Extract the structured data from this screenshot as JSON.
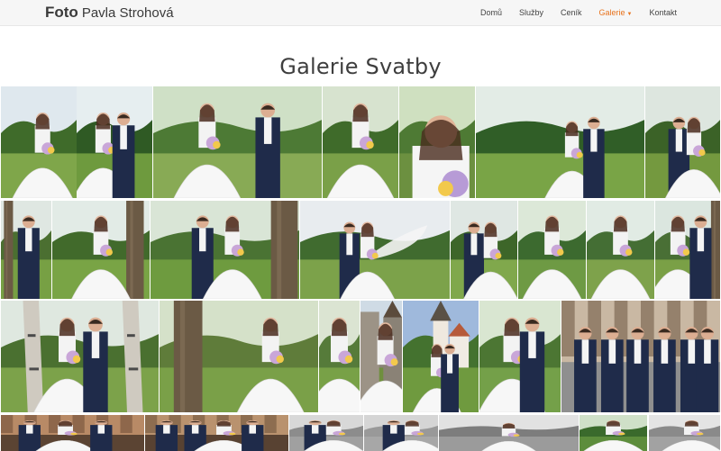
{
  "brand": {
    "bold": "Foto",
    "name": "Pavla Strohová"
  },
  "nav": [
    {
      "label": "Domů",
      "active": false
    },
    {
      "label": "Služby",
      "active": false
    },
    {
      "label": "Ceník",
      "active": false
    },
    {
      "label": "Galerie",
      "active": true,
      "dropdown": true
    },
    {
      "label": "Kontakt",
      "active": false
    }
  ],
  "page_title": "Galerie Svatby",
  "colors": {
    "accent": "#e8731d",
    "navbar_bg": "#f6f6f6"
  },
  "gallery": {
    "rows": [
      [
        {
          "scene": "bride-veil-meadow"
        },
        {
          "scene": "couple-standing-trees"
        },
        {
          "scene": "couple-kiss-closeup"
        },
        {
          "scene": "bride-bouquet"
        },
        {
          "scene": "bride-portrait-bouquet"
        },
        {
          "scene": "bride-long-veil-field"
        },
        {
          "scene": "couple-tree-trunk"
        }
      ],
      [
        {
          "scene": "groom-behind-tree"
        },
        {
          "scene": "bride-by-tree"
        },
        {
          "scene": "couple-embrace-bouquet"
        },
        {
          "scene": "couple-flying-veil"
        },
        {
          "scene": "couple-meadow-distance"
        },
        {
          "scene": "bride-lace-bouquet"
        },
        {
          "scene": "bride-smile-bouquet"
        },
        {
          "scene": "couple-tree-peek"
        }
      ],
      [
        {
          "scene": "couple-kiss-birch"
        },
        {
          "scene": "bride-tree-trunk-left"
        },
        {
          "scene": "bride-pink-bouquet"
        },
        {
          "scene": "bride-castle-wall"
        },
        {
          "scene": "couple-church-tower"
        },
        {
          "scene": "couple-pink-bouquet-closeup"
        },
        {
          "scene": "groomsmen-lifting-groom"
        }
      ],
      [
        {
          "scene": "group-indoor"
        },
        {
          "scene": "group-wooden-hall"
        },
        {
          "scene": "couple-bw-kiss"
        },
        {
          "scene": "couple-bw-close"
        },
        {
          "scene": "bw-landscape"
        },
        {
          "scene": "bride-green-bushes"
        },
        {
          "scene": "bride-bw-portrait"
        }
      ]
    ]
  }
}
